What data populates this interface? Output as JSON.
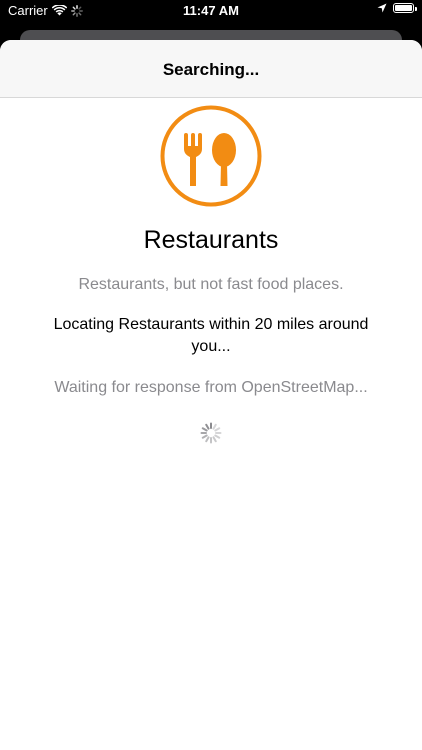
{
  "status_bar": {
    "carrier": "Carrier",
    "time": "11:47 AM"
  },
  "nav": {
    "title": "Searching..."
  },
  "category": {
    "title": "Restaurants",
    "description": "Restaurants, but not fast food places.",
    "icon": "fork-spoon-icon",
    "accent_color": "#f28c13"
  },
  "status": {
    "locating": "Locating Restaurants within 20 miles around you...",
    "waiting": "Waiting for response from OpenStreetMap..."
  }
}
